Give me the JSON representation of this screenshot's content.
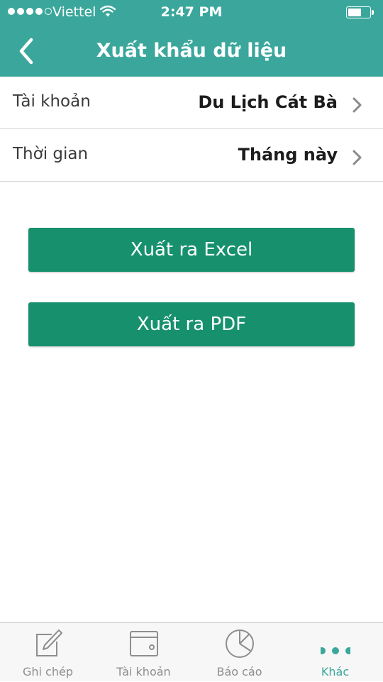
{
  "status_bar": {
    "carrier": "Viettel",
    "time": "2:47 PM"
  },
  "header": {
    "title": "Xuất khẩu dữ liệu"
  },
  "rows": [
    {
      "label": "Tài khoản",
      "value": "Du Lịch Cát Bà"
    },
    {
      "label": "Thời gian",
      "value": "Tháng này"
    }
  ],
  "buttons": {
    "excel_label": "Xuất ra Excel",
    "pdf_label": "Xuất ra PDF"
  },
  "tabs": [
    {
      "label": "Ghi chép",
      "icon": "notepad-pen-icon"
    },
    {
      "label": "Tài khoản",
      "icon": "wallet-icon"
    },
    {
      "label": "Báo cáo",
      "icon": "pie-chart-icon"
    },
    {
      "label": "Khác",
      "icon": "more-dots-icon",
      "active": true
    }
  ],
  "colors": {
    "header_bg": "#3ba79c",
    "button_bg": "#17916d",
    "tab_active": "#3ba79c",
    "tab_inactive": "#8e8e8e"
  }
}
